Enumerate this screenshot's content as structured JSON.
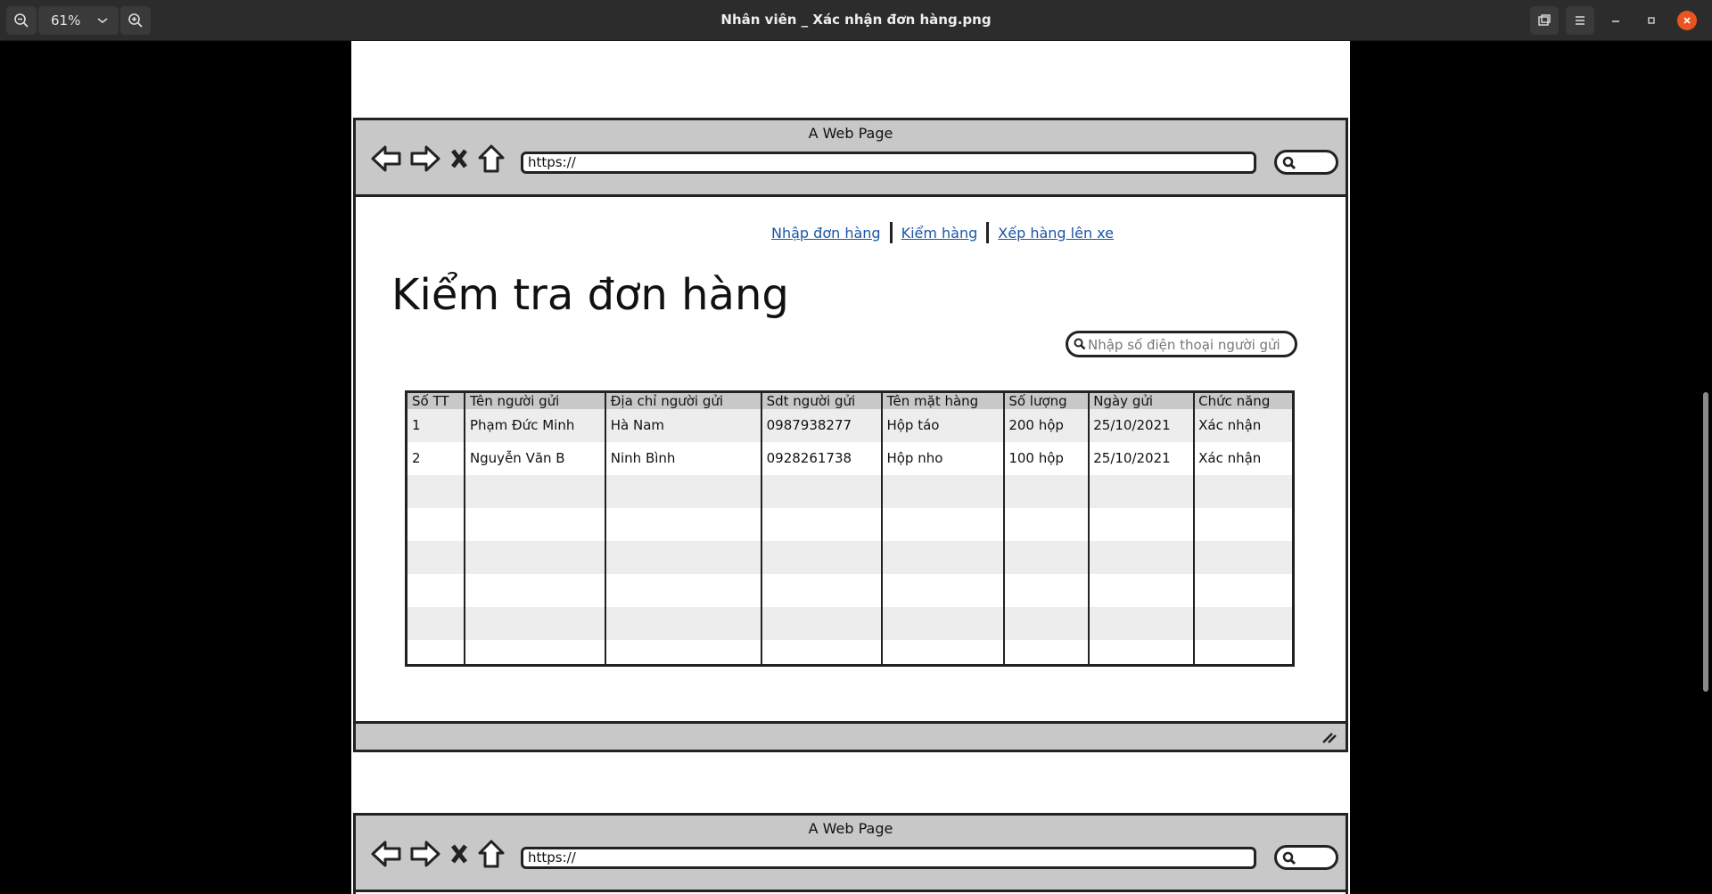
{
  "viewer": {
    "zoom": "61%",
    "title": "Nhân viên _ Xác nhận đơn hàng.png"
  },
  "browser": {
    "title": "A Web Page",
    "url": "https://"
  },
  "nav": {
    "links": [
      "Nhập đơn hàng",
      "Kiểm hàng",
      "Xếp hàng lên xe"
    ]
  },
  "page": {
    "heading": "Kiểm tra đơn hàng"
  },
  "search": {
    "placeholder": "Nhập số điện thoại người gửi"
  },
  "table": {
    "headers": [
      "Số TT",
      "Tên người gửi",
      "Địa chỉ người gửi",
      "Sdt người gửi",
      "Tên mặt hàng",
      "Số lượng",
      "Ngày gửi",
      "Chức năng"
    ],
    "rows": [
      [
        "1",
        "Phạm Đức Minh",
        "Hà Nam",
        "0987938277",
        "Hộp táo",
        "200 hộp",
        "25/10/2021",
        "Xác nhận"
      ],
      [
        "2",
        "Nguyễn Văn B",
        "Ninh Bình",
        "0928261738",
        "Hộp nho",
        "100 hộp",
        "25/10/2021",
        "Xác nhận"
      ]
    ]
  }
}
